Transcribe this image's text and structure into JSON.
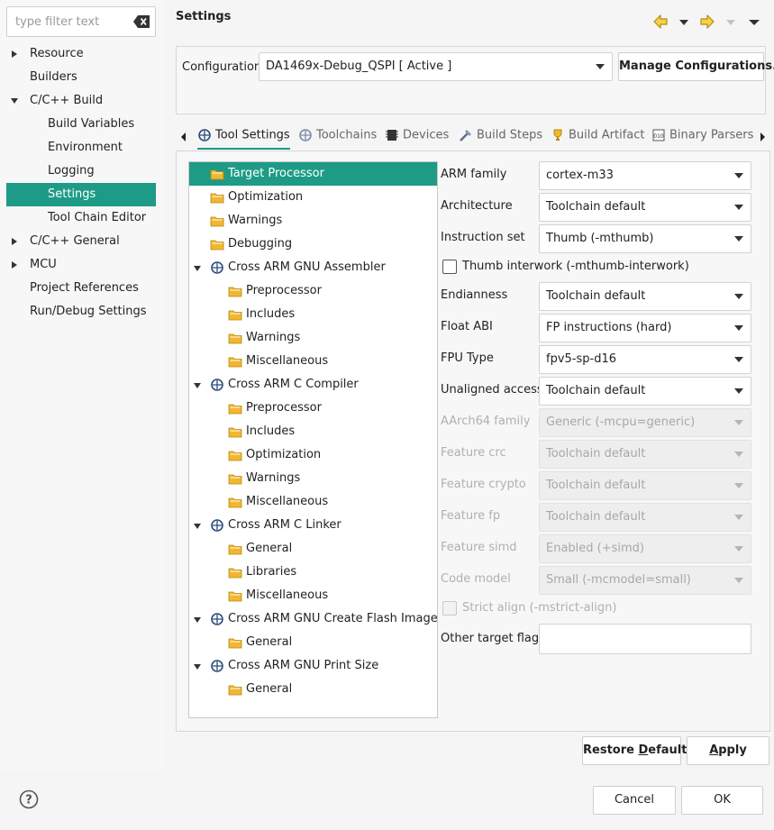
{
  "filter": {
    "placeholder": "type filter text"
  },
  "sidebar": {
    "items": [
      {
        "label": "Resource",
        "indent": 0,
        "toggle": "collapsed"
      },
      {
        "label": "Builders",
        "indent": 0,
        "toggle": "none"
      },
      {
        "label": "C/C++ Build",
        "indent": 0,
        "toggle": "expanded"
      },
      {
        "label": "Build Variables",
        "indent": 1,
        "toggle": "none"
      },
      {
        "label": "Environment",
        "indent": 1,
        "toggle": "none"
      },
      {
        "label": "Logging",
        "indent": 1,
        "toggle": "none"
      },
      {
        "label": "Settings",
        "indent": 1,
        "toggle": "none",
        "selected": true
      },
      {
        "label": "Tool Chain Editor",
        "indent": 1,
        "toggle": "none"
      },
      {
        "label": "C/C++ General",
        "indent": 0,
        "toggle": "collapsed"
      },
      {
        "label": "MCU",
        "indent": 0,
        "toggle": "collapsed"
      },
      {
        "label": "Project References",
        "indent": 0,
        "toggle": "none"
      },
      {
        "label": "Run/Debug Settings",
        "indent": 0,
        "toggle": "none"
      }
    ]
  },
  "page": {
    "title": "Settings"
  },
  "config": {
    "label": "Configuration:",
    "value": "DA1469x-Debug_QSPI  [ Active ]",
    "manage_label": "Manage Configurations..."
  },
  "tabs": [
    {
      "label": "Tool Settings",
      "icon": "tool-settings-icon",
      "active": true
    },
    {
      "label": "Toolchains",
      "icon": "toolchains-icon"
    },
    {
      "label": "Devices",
      "icon": "devices-icon"
    },
    {
      "label": "Build Steps",
      "icon": "build-steps-icon"
    },
    {
      "label": "Build Artifact",
      "icon": "build-artifact-icon"
    },
    {
      "label": "Binary Parsers",
      "icon": "binary-parsers-icon"
    }
  ],
  "tree": {
    "items": [
      {
        "label": "Target Processor",
        "level": 1,
        "kind": "folder",
        "selected": true
      },
      {
        "label": "Optimization",
        "level": 1,
        "kind": "folder"
      },
      {
        "label": "Warnings",
        "level": 1,
        "kind": "folder"
      },
      {
        "label": "Debugging",
        "level": 1,
        "kind": "folder"
      },
      {
        "label": "Cross ARM GNU Assembler",
        "level": 0,
        "kind": "tool"
      },
      {
        "label": "Preprocessor",
        "level": 2,
        "kind": "folder"
      },
      {
        "label": "Includes",
        "level": 2,
        "kind": "folder"
      },
      {
        "label": "Warnings",
        "level": 2,
        "kind": "folder"
      },
      {
        "label": "Miscellaneous",
        "level": 2,
        "kind": "folder"
      },
      {
        "label": "Cross ARM C Compiler",
        "level": 0,
        "kind": "tool"
      },
      {
        "label": "Preprocessor",
        "level": 2,
        "kind": "folder"
      },
      {
        "label": "Includes",
        "level": 2,
        "kind": "folder"
      },
      {
        "label": "Optimization",
        "level": 2,
        "kind": "folder"
      },
      {
        "label": "Warnings",
        "level": 2,
        "kind": "folder"
      },
      {
        "label": "Miscellaneous",
        "level": 2,
        "kind": "folder"
      },
      {
        "label": "Cross ARM C Linker",
        "level": 0,
        "kind": "tool"
      },
      {
        "label": "General",
        "level": 2,
        "kind": "folder"
      },
      {
        "label": "Libraries",
        "level": 2,
        "kind": "folder"
      },
      {
        "label": "Miscellaneous",
        "level": 2,
        "kind": "folder"
      },
      {
        "label": "Cross ARM GNU Create Flash Image",
        "level": 0,
        "kind": "tool"
      },
      {
        "label": "General",
        "level": 2,
        "kind": "folder"
      },
      {
        "label": "Cross ARM GNU Print Size",
        "level": 0,
        "kind": "tool"
      },
      {
        "label": "General",
        "level": 2,
        "kind": "folder"
      }
    ]
  },
  "form": {
    "arm_family": {
      "label": "ARM family",
      "value": "cortex-m33"
    },
    "architecture": {
      "label": "Architecture",
      "value": "Toolchain default"
    },
    "instruction_set": {
      "label": "Instruction set",
      "value": "Thumb (-mthumb)"
    },
    "thumb_interwork": {
      "label": "Thumb interwork (-mthumb-interwork)",
      "checked": false
    },
    "endianness": {
      "label": "Endianness",
      "value": "Toolchain default"
    },
    "float_abi": {
      "label": "Float ABI",
      "value": "FP instructions (hard)"
    },
    "fpu_type": {
      "label": "FPU Type",
      "value": "fpv5-sp-d16"
    },
    "unaligned_access": {
      "label": "Unaligned access",
      "value": "Toolchain default"
    },
    "aarch64_family": {
      "label": "AArch64 family",
      "value": "Generic (-mcpu=generic)"
    },
    "feature_crc": {
      "label": "Feature crc",
      "value": "Toolchain default"
    },
    "feature_crypto": {
      "label": "Feature crypto",
      "value": "Toolchain default"
    },
    "feature_fp": {
      "label": "Feature fp",
      "value": "Toolchain default"
    },
    "feature_simd": {
      "label": "Feature simd",
      "value": "Enabled (+simd)"
    },
    "code_model": {
      "label": "Code model",
      "value": "Small (-mcmodel=small)"
    },
    "strict_align": {
      "label": "Strict align (-mstrict-align)",
      "checked": false
    },
    "other_flags": {
      "label": "Other target flags",
      "value": ""
    }
  },
  "buttons": {
    "restore_pre": "Restore ",
    "restore_mn": "D",
    "restore_post": "efaults",
    "apply_mn": "A",
    "apply_post": "pply",
    "cancel": "Cancel",
    "ok": "OK"
  },
  "colors": {
    "accent": "#1e9b86",
    "folder": "#f2b630"
  }
}
